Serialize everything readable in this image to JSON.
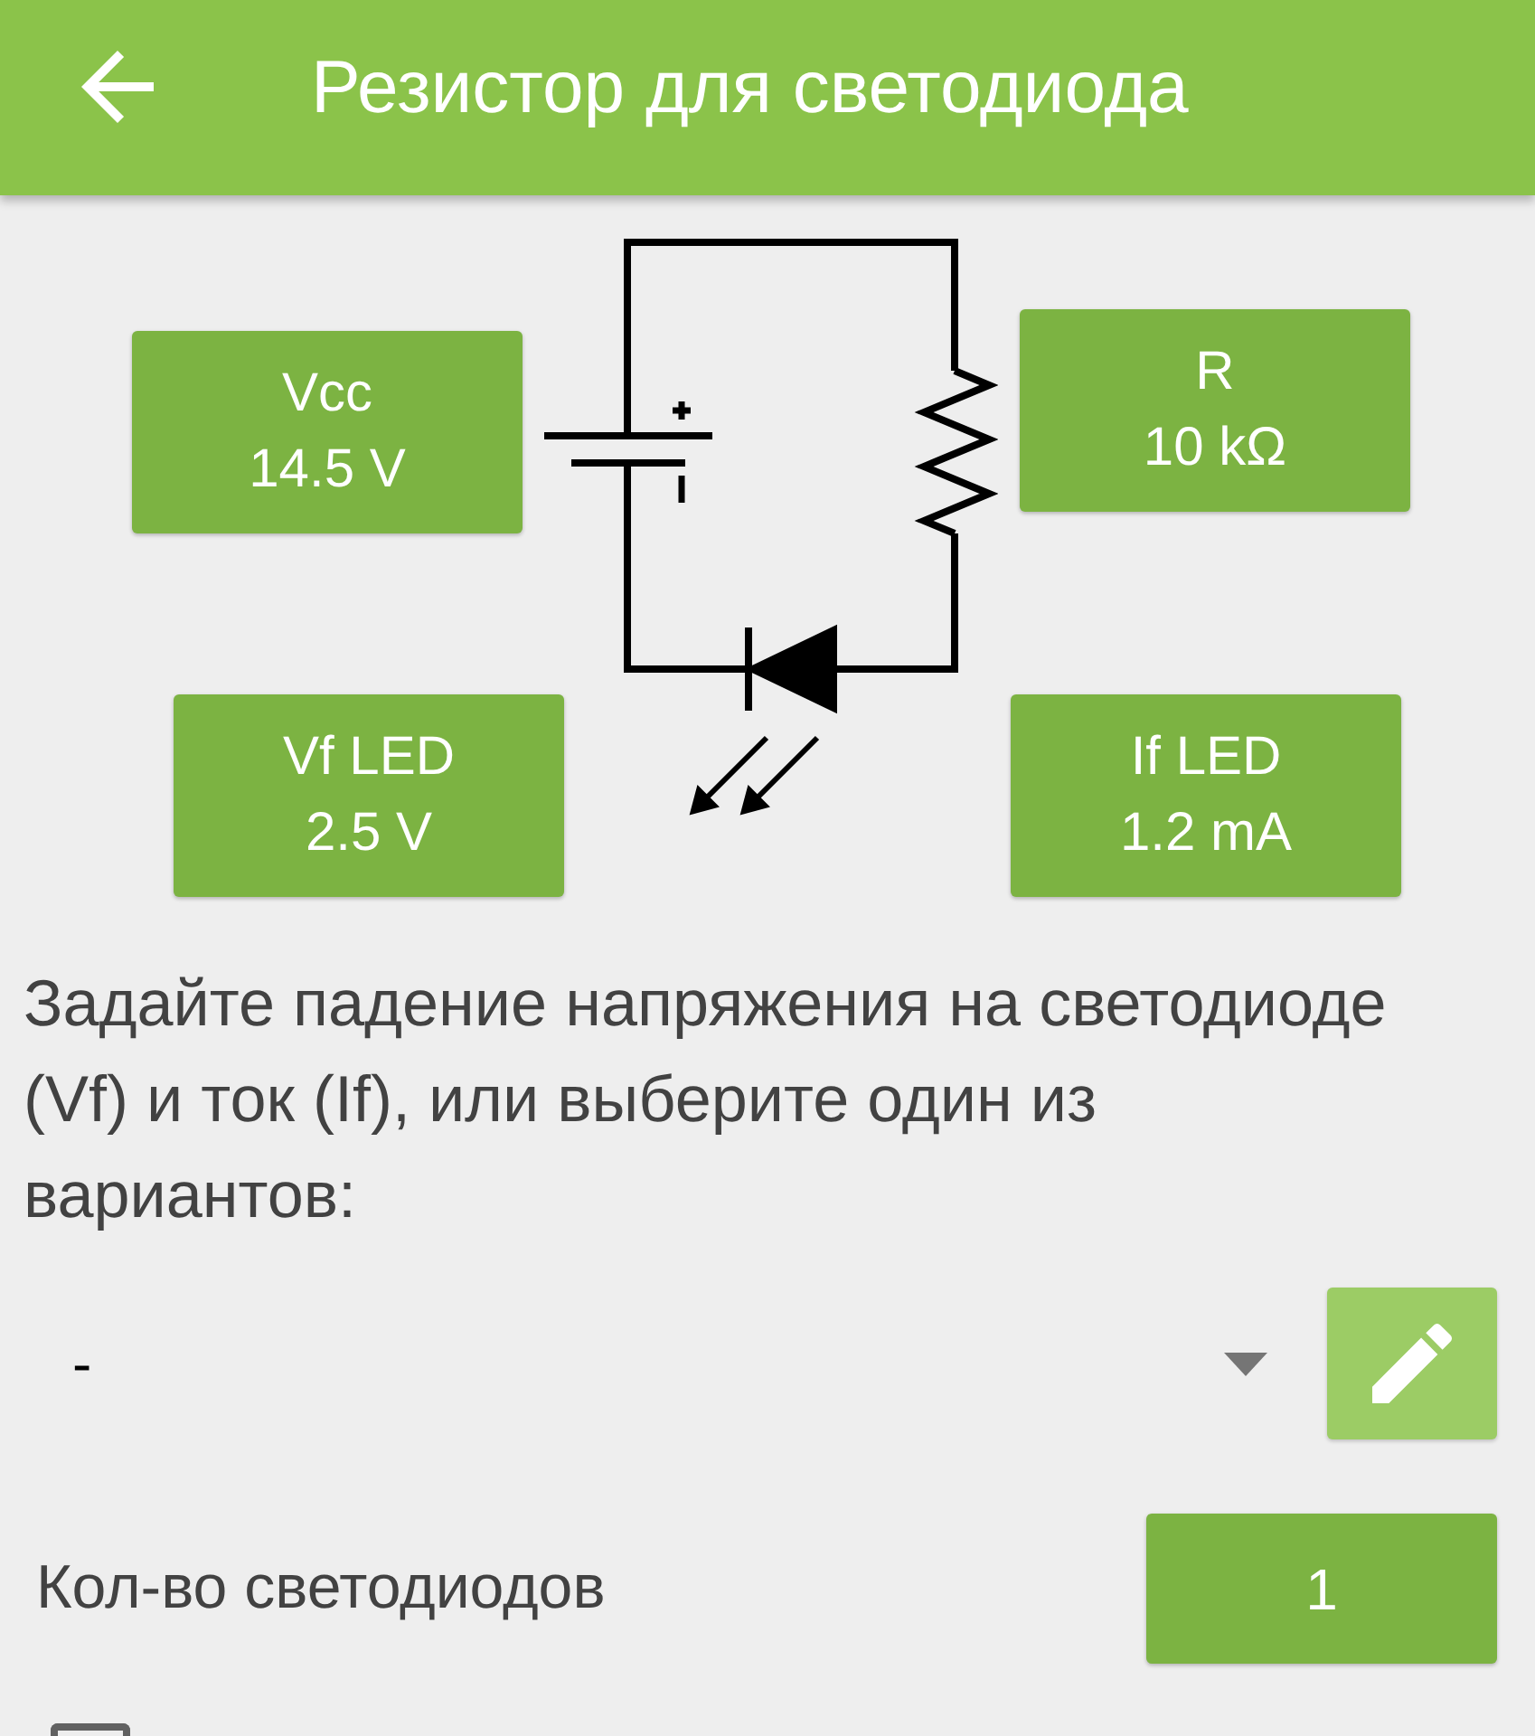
{
  "app_bar": {
    "title": "Резистор для светодиода"
  },
  "diagram": {
    "parameters": [
      {
        "kind": "supply",
        "label": "Vcc",
        "value": "14.5 V"
      },
      {
        "kind": "resistor",
        "label": "R",
        "value": "10 kΩ"
      },
      {
        "kind": "forward_voltage",
        "label": "Vf LED",
        "value": "2.5 V"
      },
      {
        "kind": "forward_current",
        "label": "If LED",
        "value": "1.2 mA"
      }
    ]
  },
  "instruction": "Задайте падение напряжения на светодиоде (Vf) и ток (If), или выберите один из вариантов:",
  "preset_select": {
    "value": "-"
  },
  "led_count": {
    "label": "Кол-во светодиодов",
    "value": "1"
  },
  "option": {
    "checked": false
  }
}
